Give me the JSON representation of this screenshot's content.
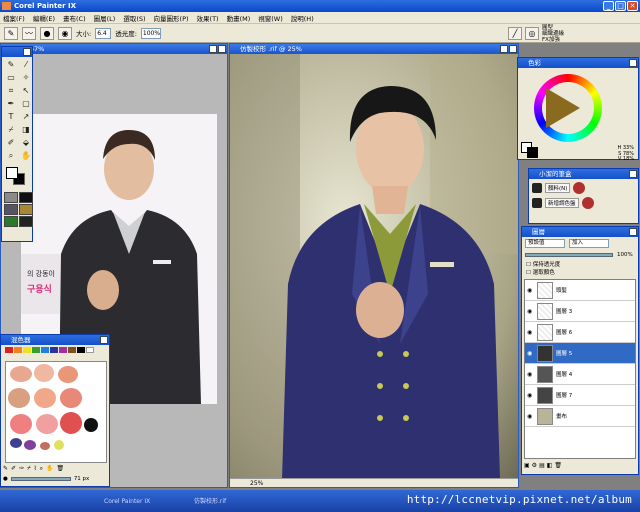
{
  "window": {
    "title": "Corel Painter IX"
  },
  "menu": [
    "檔案(F)",
    "編輯(E)",
    "畫布(C)",
    "圖層(L)",
    "選取(S)",
    "向量圖形(P)",
    "效果(T)",
    "動畫(M)",
    "視窗(W)",
    "說明(H)"
  ],
  "propbar": {
    "size_label": "大小:",
    "size_value": "6.4",
    "opacity_label": "透光度:",
    "opacity_value": "100%",
    "info_line1": "圓型",
    "info_line2": "細緻邊緣",
    "info_line3": "FX加強"
  },
  "doc1": {
    "title": "@ 16.67%",
    "text_korean": "의 강동이",
    "text_korean2": "구용식"
  },
  "doc2": {
    "title": "仿製校形 .rif @ 25%",
    "zoom": "25%"
  },
  "colorwheel": {
    "title": "色彩",
    "h": "H 33%",
    "s": "S 78%",
    "v": "V 18%"
  },
  "brushpal": {
    "title": "小潔的筆盒",
    "row1": "顏料(N)",
    "row2": "新增調色盤"
  },
  "layers": {
    "title": "圖層",
    "composite": "預設值",
    "method": "加入",
    "opacity": "100%",
    "preserve": "保持透光度",
    "pick": "選取顏色",
    "items": [
      {
        "name": "頭髮",
        "selected": false
      },
      {
        "name": "圖層 3",
        "selected": false
      },
      {
        "name": "圖層 6",
        "selected": false
      },
      {
        "name": "圖層 5",
        "selected": true
      },
      {
        "name": "圖層 4",
        "selected": false
      },
      {
        "name": "圖層 7",
        "selected": false
      },
      {
        "name": "畫布",
        "selected": false
      }
    ]
  },
  "colorset": {
    "title": "混色器",
    "zoom": "71 px"
  },
  "taskbar": {
    "item1": "Corel Painter IX",
    "item2": "仿製校形.rif"
  },
  "watermark": "http://lccnetvip.pixnet.net/album"
}
